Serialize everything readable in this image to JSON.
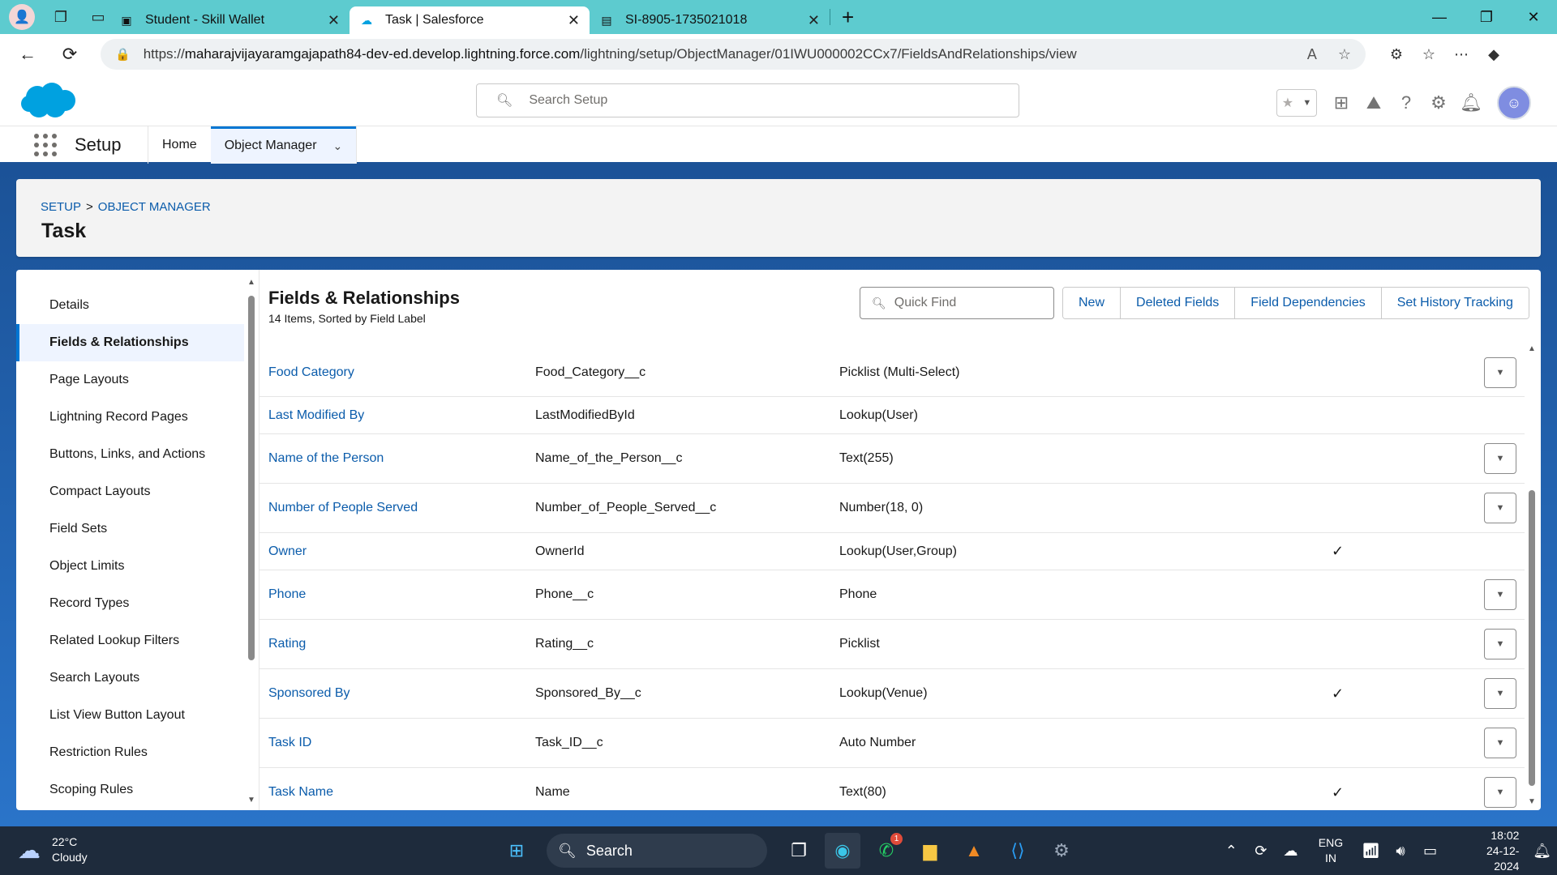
{
  "browser": {
    "tabs": [
      {
        "title": "Student - Skill Wallet",
        "icon": "skill-wallet-icon"
      },
      {
        "title": "Task | Salesforce",
        "icon": "salesforce-icon"
      },
      {
        "title": "SI-8905-1735021018",
        "icon": "document-icon"
      }
    ],
    "url_prefix": "https://",
    "url_host": "maharajvijayaramgajapath84-dev-ed.develop.lightning.force.com",
    "url_path": "/lightning/setup/ObjectManager/01IWU000002CCx7/FieldsAndRelationships/view"
  },
  "header": {
    "search_placeholder": "Search Setup"
  },
  "appnav": {
    "app_name": "Setup",
    "items": [
      {
        "label": "Home"
      },
      {
        "label": "Object Manager"
      }
    ]
  },
  "breadcrumb": {
    "setup": "SETUP",
    "separator": ">",
    "object_manager": "OBJECT MANAGER",
    "title": "Task"
  },
  "sidebar": {
    "items": [
      {
        "label": "Details"
      },
      {
        "label": "Fields & Relationships"
      },
      {
        "label": "Page Layouts"
      },
      {
        "label": "Lightning Record Pages"
      },
      {
        "label": "Buttons, Links, and Actions"
      },
      {
        "label": "Compact Layouts"
      },
      {
        "label": "Field Sets"
      },
      {
        "label": "Object Limits"
      },
      {
        "label": "Record Types"
      },
      {
        "label": "Related Lookup Filters"
      },
      {
        "label": "Search Layouts"
      },
      {
        "label": "List View Button Layout"
      },
      {
        "label": "Restriction Rules"
      },
      {
        "label": "Scoping Rules"
      }
    ]
  },
  "content": {
    "title": "Fields & Relationships",
    "subtitle": "14 Items, Sorted by Field Label",
    "quick_find_placeholder": "Quick Find",
    "buttons": {
      "new": "New",
      "deleted": "Deleted Fields",
      "dependencies": "Field Dependencies",
      "history": "Set History Tracking"
    },
    "rows": [
      {
        "label": "Food Category",
        "api": "Food_Category__c",
        "type": "Picklist (Multi-Select)",
        "indexed": "",
        "menu": true
      },
      {
        "label": "Last Modified By",
        "api": "LastModifiedById",
        "type": "Lookup(User)",
        "indexed": "",
        "menu": false
      },
      {
        "label": "Name of the Person",
        "api": "Name_of_the_Person__c",
        "type": "Text(255)",
        "indexed": "",
        "menu": true
      },
      {
        "label": "Number of People Served",
        "api": "Number_of_People_Served__c",
        "type": "Number(18, 0)",
        "indexed": "",
        "menu": true
      },
      {
        "label": "Owner",
        "api": "OwnerId",
        "type": "Lookup(User,Group)",
        "indexed": "✓",
        "menu": false
      },
      {
        "label": "Phone",
        "api": "Phone__c",
        "type": "Phone",
        "indexed": "",
        "menu": true
      },
      {
        "label": "Rating",
        "api": "Rating__c",
        "type": "Picklist",
        "indexed": "",
        "menu": true
      },
      {
        "label": "Sponsored By",
        "api": "Sponsored_By__c",
        "type": "Lookup(Venue)",
        "indexed": "✓",
        "menu": true
      },
      {
        "label": "Task ID",
        "api": "Task_ID__c",
        "type": "Auto Number",
        "indexed": "",
        "menu": true
      },
      {
        "label": "Task Name",
        "api": "Name",
        "type": "Text(80)",
        "indexed": "✓",
        "menu": true
      }
    ]
  },
  "taskbar": {
    "temperature": "22°C",
    "weather": "Cloudy",
    "search_label": "Search",
    "lang_top": "ENG",
    "lang_bottom": "IN",
    "time": "18:02",
    "date": "24-12-2024",
    "whatsapp_badge": "1"
  }
}
